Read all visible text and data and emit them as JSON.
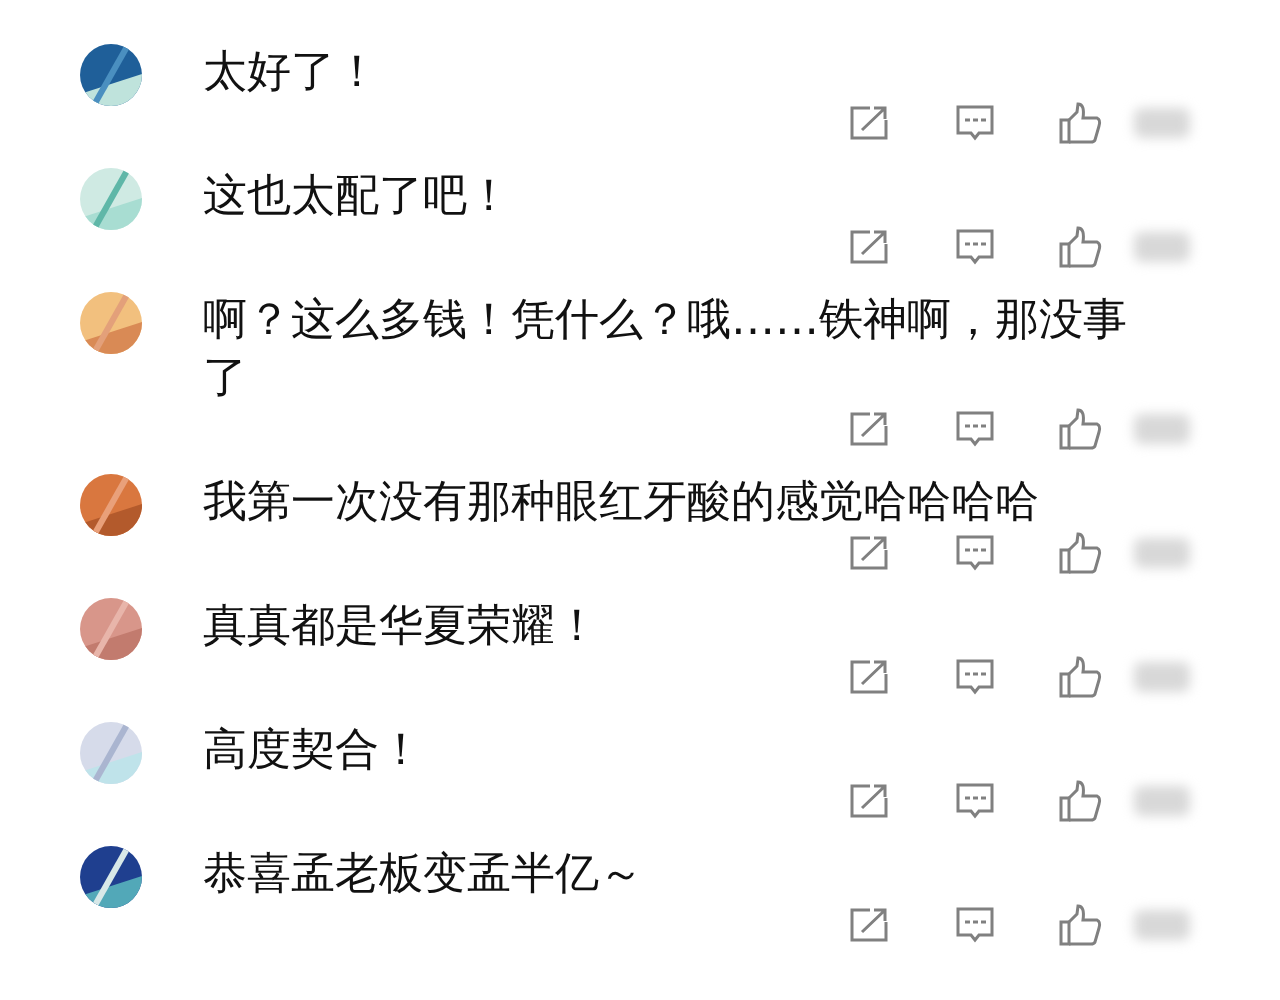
{
  "comments": [
    {
      "text": "太好了！"
    },
    {
      "text": "这也太配了吧！"
    },
    {
      "text": "啊？这么多钱！凭什么？哦……铁神啊，那没事了"
    },
    {
      "text": "我第一次没有那种眼红牙酸的感觉哈哈哈哈"
    },
    {
      "text": "真真都是华夏荣耀！"
    },
    {
      "text": "高度契合！"
    },
    {
      "text": "恭喜孟老板变孟半亿～"
    }
  ]
}
